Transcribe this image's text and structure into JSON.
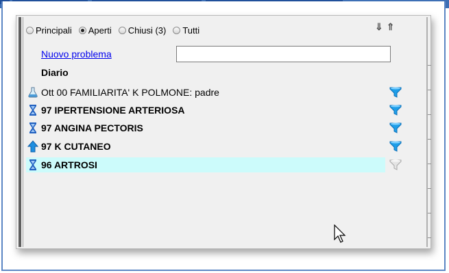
{
  "filters": {
    "options": [
      {
        "label": "Principali",
        "selected": false
      },
      {
        "label": "Aperti",
        "selected": true
      },
      {
        "label": "Chiusi (3)",
        "selected": false
      },
      {
        "label": "Tutti",
        "selected": false
      }
    ]
  },
  "new_problem": {
    "link_label": "Nuovo problema",
    "input_value": ""
  },
  "diary_label": "Diario",
  "problems": [
    {
      "text": "Ott 00 FAMILIARITA' K POLMONE: padre",
      "bold": false,
      "icon": "flask-icon",
      "filter": "blue-funnel-icon",
      "highlighted": false
    },
    {
      "text": "97 IPERTENSIONE ARTERIOSA",
      "bold": true,
      "icon": "hourglass-icon",
      "filter": "blue-funnel-icon",
      "highlighted": false
    },
    {
      "text": "97 ANGINA PECTORIS",
      "bold": true,
      "icon": "hourglass-icon",
      "filter": "blue-funnel-icon",
      "highlighted": false
    },
    {
      "text": "97 K CUTANEO",
      "bold": true,
      "icon": "up-arrow-icon",
      "filter": "blue-funnel-icon",
      "highlighted": false
    },
    {
      "text": "96 ARTROSI",
      "bold": true,
      "icon": "hourglass-icon",
      "filter": "gray-funnel-icon",
      "highlighted": true
    }
  ],
  "colors": {
    "highlight": "#ccfbfb",
    "funnel_active": "#1e9ee8",
    "funnel_inactive": "#c8c8c8",
    "hourglass": "#1f5fbf",
    "arrow": "#1e8ee0"
  }
}
